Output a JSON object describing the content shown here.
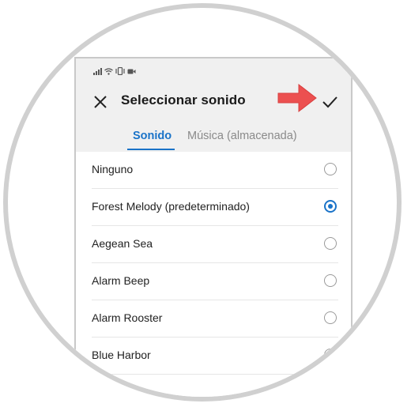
{
  "header": {
    "title": "Seleccionar sonido"
  },
  "tabs": [
    {
      "label": "Sonido",
      "active": true
    },
    {
      "label": "Música (almacenada)",
      "active": false
    }
  ],
  "sounds": [
    {
      "label": "Ninguno",
      "selected": false
    },
    {
      "label": "Forest Melody (predeterminado)",
      "selected": true
    },
    {
      "label": "Aegean Sea",
      "selected": false
    },
    {
      "label": "Alarm Beep",
      "selected": false
    },
    {
      "label": "Alarm Rooster",
      "selected": false
    },
    {
      "label": "Blue Harbor",
      "selected": false
    }
  ],
  "colors": {
    "accent": "#1a73c8",
    "arrow": "#ec5050",
    "header_bg": "#f0f0f0"
  },
  "icons": {
    "close": "close-icon",
    "confirm": "checkmark-icon",
    "annotation": "arrow-right-icon"
  }
}
